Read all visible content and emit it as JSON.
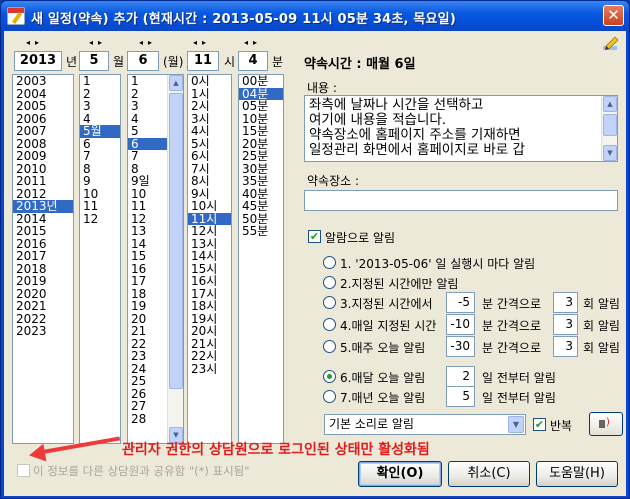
{
  "window": {
    "title": "새 일정(약속) 추가   (현재시간 : 2013-05-09 11시 05분 34초, 목요일)",
    "close_symbol": "✕"
  },
  "spinners": {
    "year": {
      "value": "2013",
      "unit": "년"
    },
    "month": {
      "value": "5",
      "unit": "월"
    },
    "day": {
      "value": "6",
      "unit": "(월)"
    },
    "hour": {
      "value": "11",
      "unit": "시"
    },
    "minute": {
      "value": "4",
      "unit": "분"
    },
    "arrows": "◂▸"
  },
  "lists": {
    "years": [
      "2003",
      "2004",
      "2005",
      "2006",
      "2007",
      "2008",
      "2009",
      "2010",
      "2011",
      "2012",
      "2013년",
      "2014",
      "2015",
      "2016",
      "2017",
      "2018",
      "2019",
      "2020",
      "2021",
      "2022",
      "2023"
    ],
    "years_selected": 10,
    "months": [
      "1",
      "2",
      "3",
      "4",
      "5월",
      "6",
      "7",
      "8",
      "9",
      "10",
      "11",
      "12"
    ],
    "months_selected": 4,
    "days": [
      "1",
      "2",
      "3",
      "4",
      "5",
      "6",
      "7",
      "8",
      "9일",
      "10",
      "11",
      "12",
      "13",
      "14",
      "15",
      "16",
      "17",
      "18",
      "19",
      "20",
      "21",
      "22",
      "23",
      "24",
      "25",
      "26",
      "27",
      "28"
    ],
    "days_selected": 5,
    "hours": [
      "0시",
      "1시",
      "2시",
      "3시",
      "4시",
      "5시",
      "6시",
      "7시",
      "8시",
      "9시",
      "10시",
      "11시",
      "12시",
      "13시",
      "14시",
      "15시",
      "16시",
      "17시",
      "18시",
      "19시",
      "20시",
      "21시",
      "22시",
      "23시"
    ],
    "hours_selected": 11,
    "minutes": [
      "00분",
      "04분",
      "05분",
      "10분",
      "15분",
      "20분",
      "25분",
      "30분",
      "35분",
      "40분",
      "45분",
      "50분",
      "55분"
    ],
    "minutes_selected": 1
  },
  "appointment_time_label": "약속시간 : 매월 6일",
  "content": {
    "label": "내용 :",
    "lines": [
      "좌측에 날짜나 시간을 선택하고",
      "여기에 내용을 적습니다.",
      "약속장소에 홈페이지 주소를 기재하면",
      "일정관리 화면에서 홈페이지로 바로 갑"
    ]
  },
  "location": {
    "label": "약속장소 :",
    "value": ""
  },
  "alarm": {
    "checkbox_label": "알람으로 알림",
    "checked": true,
    "options": [
      {
        "label": "1. '2013-05-06' 일 실행시 마다 알림",
        "selected": false
      },
      {
        "label": "2.지정된 시간에만 알림",
        "selected": false
      },
      {
        "label": "3.지정된 시간에서",
        "value": "-5",
        "mid": "분 간격으로",
        "count": "3",
        "suffix": "회 알림",
        "selected": false
      },
      {
        "label": "4.매일 지정된 시간",
        "value": "-10",
        "mid": "분 간격으로",
        "count": "3",
        "suffix": "회 알림",
        "selected": false
      },
      {
        "label": "5.매주 오늘 알림",
        "value": "-30",
        "mid": "분 간격으로",
        "count": "3",
        "suffix": "회 알림",
        "selected": false
      },
      {
        "label": "6.매달 오늘 알림",
        "value": "2",
        "mid": "일 전부터 알림",
        "selected": true
      },
      {
        "label": "7.매년 오늘 알림",
        "value": "5",
        "mid": "일 전부터 알림",
        "selected": false
      }
    ],
    "sound_select": "기본 소리로 알림",
    "repeat_label": "반복",
    "repeat_checked": true
  },
  "share_checkbox_label": "이 정보를 다른 상담원과 공유함 \"(*) 표시됨\"",
  "annotation": "관리자 권한의 상담원으로 로그인된 상태만 활성화됨",
  "buttons": {
    "ok": "확인(O)",
    "cancel": "취소(C)",
    "help": "도움말(H)"
  },
  "colors": {
    "selection": "#316ac5",
    "annotation": "#e01d1d",
    "titlebar": "#0a58e0"
  }
}
